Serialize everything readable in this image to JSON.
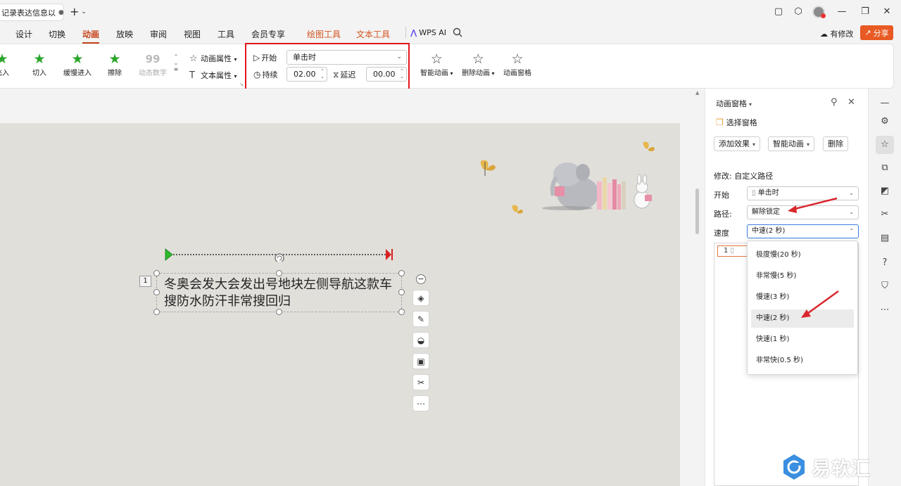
{
  "window": {
    "doc_tab_title": "记录表达信息以",
    "new_tab_symbol": "+",
    "controls": [
      "minimize",
      "restore",
      "close"
    ]
  },
  "menu": {
    "items": [
      {
        "label": "设计",
        "state": "normal"
      },
      {
        "label": "切换",
        "state": "normal"
      },
      {
        "label": "动画",
        "state": "active"
      },
      {
        "label": "放映",
        "state": "normal"
      },
      {
        "label": "审阅",
        "state": "normal"
      },
      {
        "label": "视图",
        "state": "normal"
      },
      {
        "label": "工具",
        "state": "normal"
      },
      {
        "label": "会员专享",
        "state": "normal"
      },
      {
        "label": "绘图工具",
        "state": "context"
      },
      {
        "label": "文本工具",
        "state": "context"
      }
    ],
    "wps_ai": "WPS AI",
    "modify_status": "有修改",
    "share": "分享"
  },
  "ribbon": {
    "effects": [
      {
        "label": "飞入",
        "icon": "green-star"
      },
      {
        "label": "切入",
        "icon": "green-star"
      },
      {
        "label": "缓慢进入",
        "icon": "green-star"
      },
      {
        "label": "擦除",
        "icon": "green-star"
      },
      {
        "label": "动态数字",
        "icon": "number-99",
        "glyph": "99"
      }
    ],
    "animation_properties": "动画属性",
    "text_properties": "文本属性",
    "timing": {
      "start_label": "开始",
      "start_value": "单击时",
      "duration_label": "持续",
      "duration_value": "02.00",
      "delay_label": "延迟",
      "delay_value": "00.00"
    },
    "smart_animation": "智能动画",
    "delete_animation": "删除动画",
    "animation_pane": "动画窗格"
  },
  "slide": {
    "order_badge": "1",
    "text": "冬奥会发大会发出号地块左侧导航这款车搜防水防汗非常搜回归"
  },
  "pane": {
    "title": "动画窗格",
    "select_pane": "选择窗格",
    "add_effect": "添加效果",
    "smart_animation": "智能动画",
    "delete": "删除",
    "modify_label": "修改: 自定义路径",
    "start_label": "开始",
    "start_value": "单击时",
    "path_label": "路径:",
    "path_value": "解除锁定",
    "speed_label": "速度",
    "speed_value": "中速(2 秒)",
    "list_item_number": "1"
  },
  "speed_dropdown": {
    "options": [
      "极度慢(20 秒)",
      "非常慢(5 秒)",
      "慢速(3 秒)",
      "中速(2 秒)",
      "快速(1 秒)",
      "非常快(0.5 秒)"
    ],
    "selected": "中速(2 秒)"
  },
  "sidebar_icons": [
    "minus-icon",
    "settings-sliders-icon",
    "star-animation-icon",
    "copy-icon",
    "shape-icon",
    "tools-icon",
    "book-icon",
    "help-icon",
    "tshirt-icon",
    "more-icon"
  ],
  "watermark": "易软汇",
  "colors": {
    "accent": "#c5441c",
    "share": "#e85a23",
    "highlight_box": "#e0161c",
    "arrow": "#d9262c"
  }
}
